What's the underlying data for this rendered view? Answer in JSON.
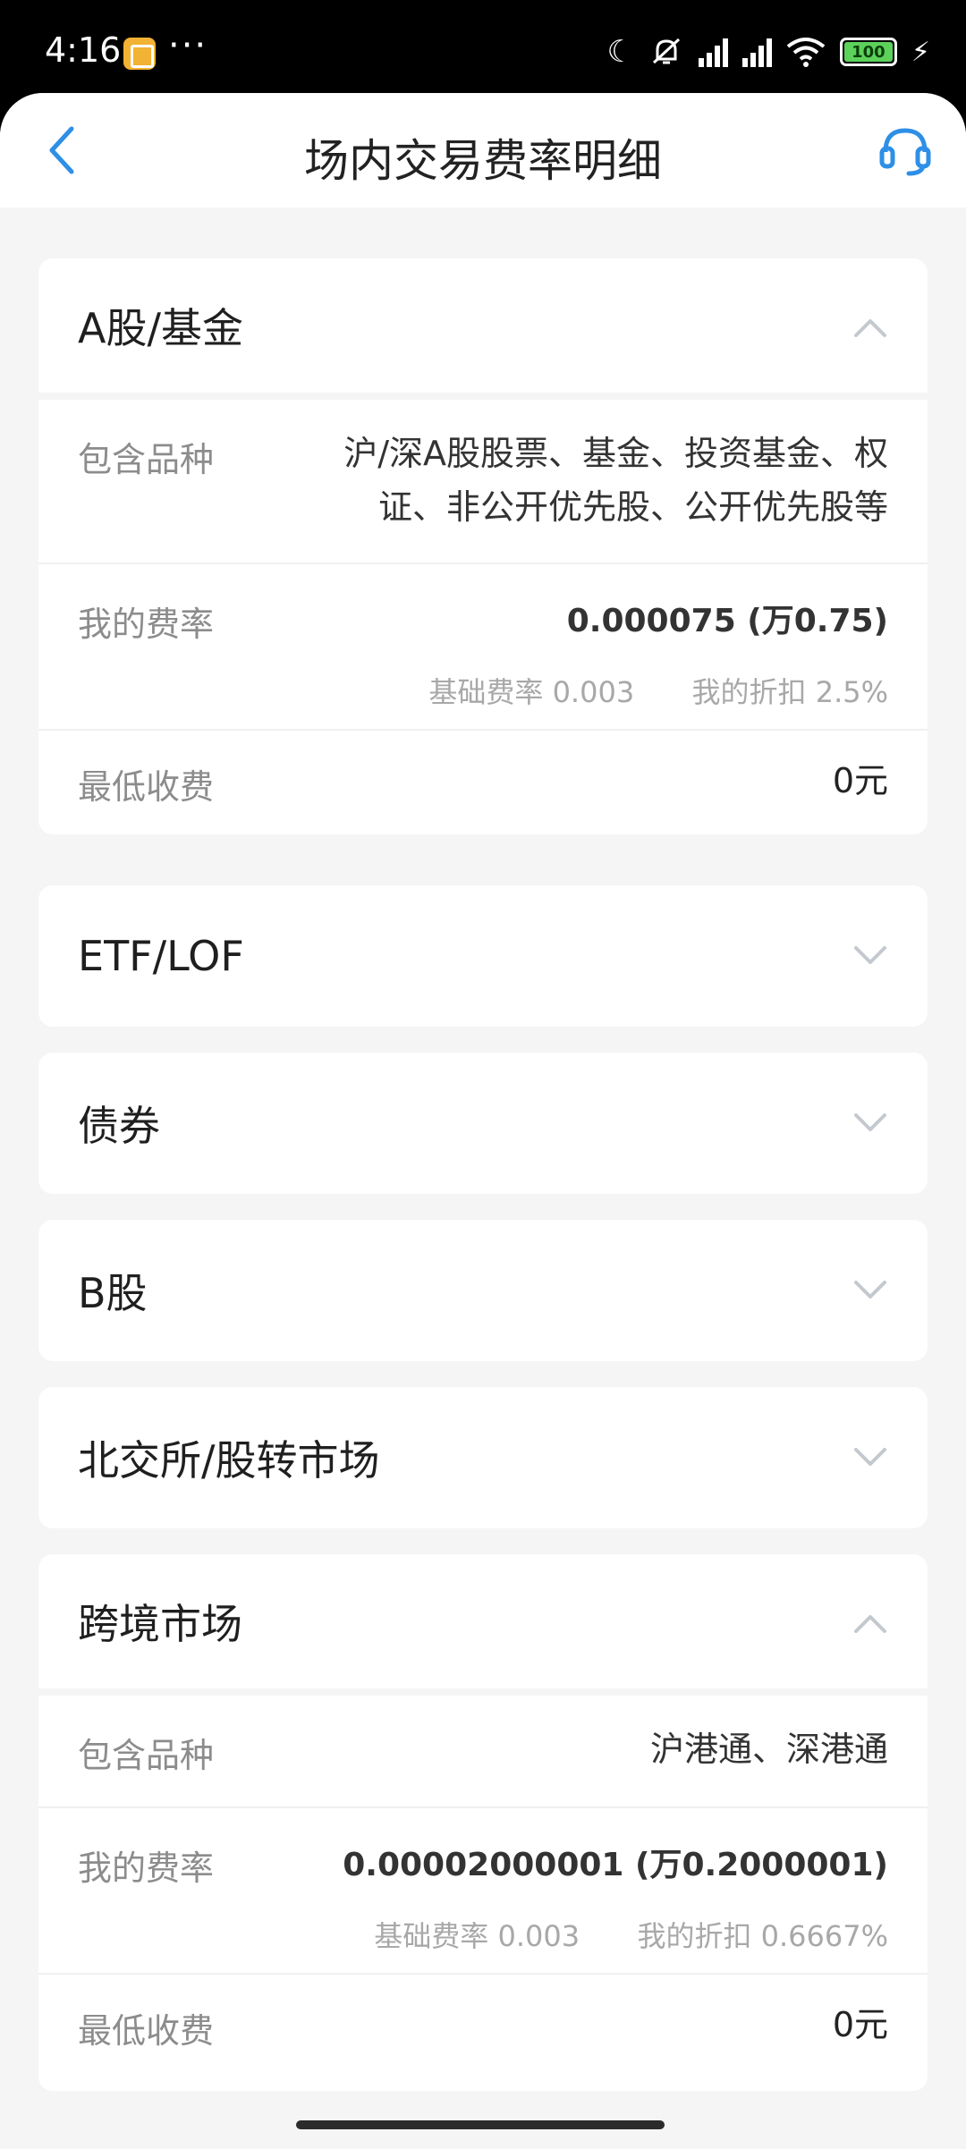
{
  "status_bar": {
    "time": "4:16",
    "dots": "···",
    "battery": "100"
  },
  "header": {
    "title": "场内交易费率明细"
  },
  "icons": {
    "back": "chevron-left-icon",
    "service": "headset-icon",
    "expand": "chevron-down-icon",
    "collapse": "chevron-up-icon"
  },
  "colors": {
    "accent": "#2e8fe6",
    "background": "#f5f5f6"
  },
  "sections": {
    "a_share": {
      "title": "A股/基金",
      "expanded": true,
      "includes_label": "包含品种",
      "includes_value": "沪/深A股股票、基金、投资基金、权证、非公开优先股、公开优先股等",
      "rate_label": "我的费率",
      "rate_value": "0.000075 (万0.75)",
      "base_rate_label": "基础费率",
      "base_rate_value": "0.003",
      "discount_label": "我的折扣",
      "discount_value": "2.5%",
      "min_fee_label": "最低收费",
      "min_fee_value": "0元"
    },
    "etf": {
      "title": "ETF/LOF",
      "expanded": false
    },
    "bond": {
      "title": "债券",
      "expanded": false
    },
    "b_share": {
      "title": "B股",
      "expanded": false
    },
    "bse": {
      "title": "北交所/股转市场",
      "expanded": false
    },
    "cross_border": {
      "title": "跨境市场",
      "expanded": true,
      "includes_label": "包含品种",
      "includes_value": "沪港通、深港通",
      "rate_label": "我的费率",
      "rate_value": "0.00002000001 (万0.2000001)",
      "base_rate_label": "基础费率",
      "base_rate_value": "0.003",
      "discount_label": "我的折扣",
      "discount_value": "0.6667%",
      "min_fee_label": "最低收费",
      "min_fee_value": "0元"
    }
  }
}
